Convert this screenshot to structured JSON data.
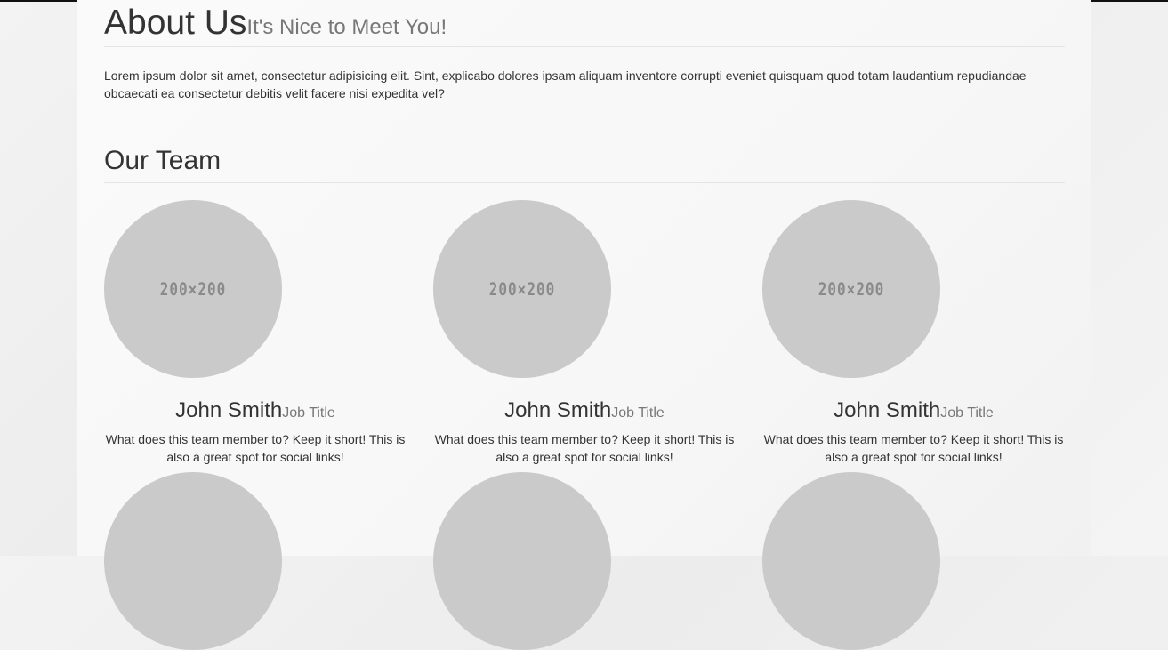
{
  "about": {
    "title": "About Us",
    "subtitle": "It's Nice to Meet You!",
    "text": "Lorem ipsum dolor sit amet, consectetur adipisicing elit. Sint, explicabo dolores ipsam aliquam inventore corrupti eveniet quisquam quod totam laudantium repudiandae obcaecati ea consectetur debitis velit facere nisi expedita vel?"
  },
  "team": {
    "title": "Our Team",
    "members": [
      {
        "placeholder": "200×200",
        "name": "John Smith",
        "job": "Job Title",
        "desc": "What does this team member to? Keep it short! This is also a great spot for social links!"
      },
      {
        "placeholder": "200×200",
        "name": "John Smith",
        "job": "Job Title",
        "desc": "What does this team member to? Keep it short! This is also a great spot for social links!"
      },
      {
        "placeholder": "200×200",
        "name": "John Smith",
        "job": "Job Title",
        "desc": "What does this team member to? Keep it short! This is also a great spot for social links!"
      }
    ]
  }
}
